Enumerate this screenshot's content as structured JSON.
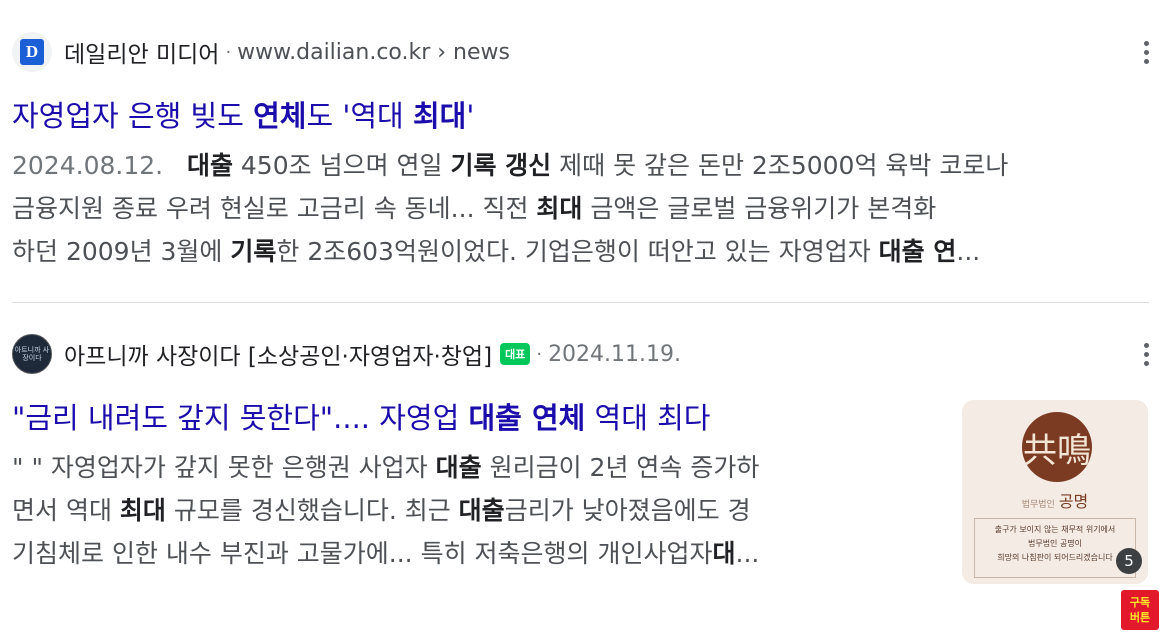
{
  "results": [
    {
      "favicon_letter": "D",
      "site_name": "데일리안 미디어",
      "url": "www.dailian.co.kr › news",
      "title": {
        "parts": [
          "자영업자 은행 빚도 ",
          "연체",
          "도 '역대 ",
          "최대",
          "'"
        ]
      },
      "snippet": {
        "line1": [
          "2024.08.12.",
          "대출",
          " 450조 넘으며 연일 ",
          "기록 갱신",
          " 제때 못 갚은 돈만 2조5000억 육박 코로나"
        ],
        "line2": [
          "금융지원 종료 우려 현실로 고금리 속 동네... 직전 ",
          "최대",
          " 금액은 글로벌 금융위기가 본격화"
        ],
        "line3": [
          "하던 2009년 3월에 ",
          "기록",
          "한 2조603억원이었다. 기업은행이 떠안고 있는 자영업자 ",
          "대출 연",
          "..."
        ]
      }
    },
    {
      "favicon_text": "아트니까 사장이다",
      "site_name": "아프니까 사장이다 [소상공인·자영업자·창업]",
      "badge": "대표",
      "date": "2024.11.19.",
      "title": {
        "parts": [
          "\"금리 내려도 갚지 못한다\".... 자영업 ",
          "대출 연체",
          " 역대 최다"
        ]
      },
      "snippet": {
        "line1": [
          "\" \" 자영업자가 갚지 못한 은행권 사업자 ",
          "대출",
          " 원리금이 2년 연속 증가하"
        ],
        "line2": [
          "면서 역대 ",
          "최대",
          " 규모를 경신했습니다. 최근 ",
          "대출",
          "금리가 낮아졌음에도 경"
        ],
        "line3": [
          "기침체로 인한 내수 부진과 고물가에... 특히 저축은행의 개인사업자",
          "대",
          "..."
        ]
      },
      "thumbnail": {
        "logo_glyph": "共鳴",
        "brand_small": "법무법인",
        "brand": "공명",
        "box_line1": "출구가 보이지 않는 채무적 위기에서",
        "box_line2": "법무법인 공명이",
        "box_line3": "희망의 나침판이 되어드리겠습니다",
        "count": "5"
      }
    }
  ],
  "overlay": {
    "subscribe_line1": "구독",
    "subscribe_line2": "버튼"
  }
}
